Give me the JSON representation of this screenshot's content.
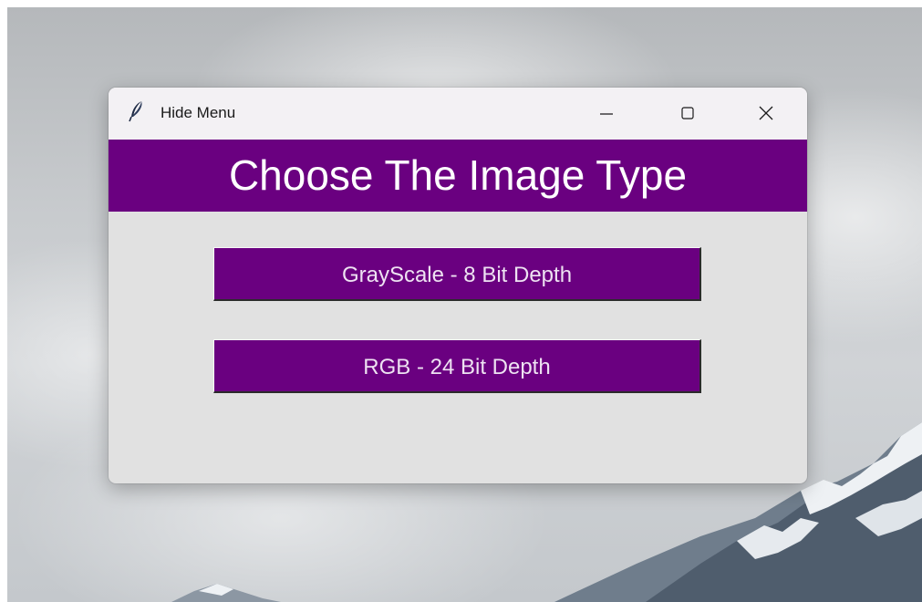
{
  "window": {
    "title": "Hide Menu",
    "controls": {
      "minimize_icon": "minimize-icon",
      "maximize_icon": "maximize-icon",
      "close_icon": "close-icon"
    },
    "app_icon": "feather-icon"
  },
  "banner": {
    "heading": "Choose The Image Type"
  },
  "options": [
    {
      "label": "GrayScale - 8 Bit Depth"
    },
    {
      "label": "RGB - 24 Bit Depth"
    }
  ],
  "colors": {
    "accent": "#6a0080",
    "window_background": "#e1e1e1",
    "titlebar_background": "#f3f1f4",
    "button_text": "#eee2f2",
    "heading_text": "#ffffff"
  }
}
